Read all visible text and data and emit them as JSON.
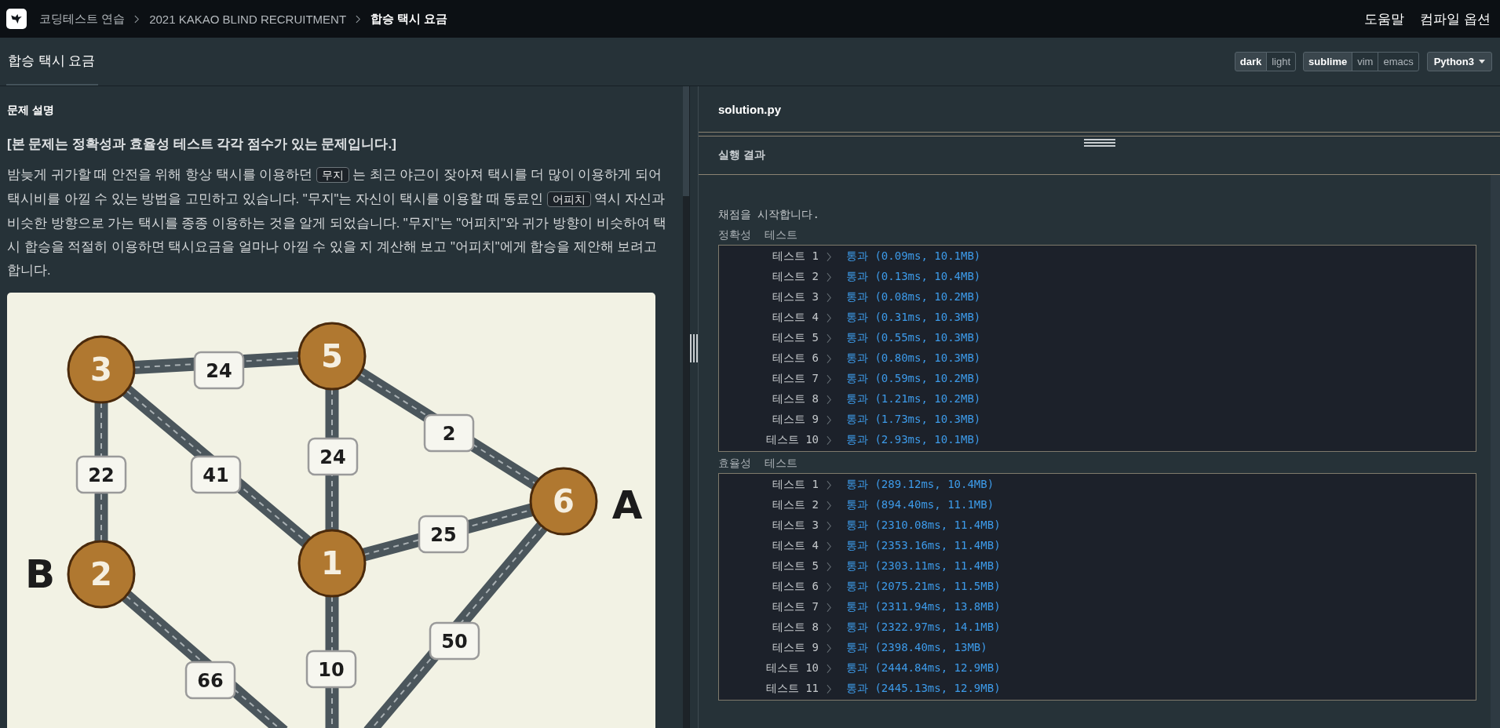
{
  "nav": {
    "breadcrumbs": [
      "코딩테스트 연습",
      "2021 KAKAO BLIND RECRUITMENT",
      "합승 택시 요금"
    ],
    "links": [
      "도움말",
      "컴파일 옵션"
    ]
  },
  "header": {
    "title": "합승 택시 요금",
    "themes": [
      {
        "label": "dark",
        "selected": true
      },
      {
        "label": "light",
        "selected": false
      }
    ],
    "keymaps": [
      {
        "label": "sublime",
        "selected": true
      },
      {
        "label": "vim",
        "selected": false
      },
      {
        "label": "emacs",
        "selected": false
      }
    ],
    "language": "Python3"
  },
  "problem": {
    "section": "문제 설명",
    "notice": "[본 문제는 정확성과 효율성 테스트 각각 점수가 있는 문제입니다.]",
    "paragraph": [
      {
        "kind": "text",
        "text": "밤늦게 귀가할 때 안전을 위해 항상 택시를 이용하던 "
      },
      {
        "kind": "code",
        "text": "무지"
      },
      {
        "kind": "text",
        "text": " 는 최근 야근이 잦아져 택시를 더 많이 이용하게 되어 택시비를 아낄 수 있는 방법을 고민하고 있습니다. \"무지\"는 자신이 택시를 이용할 때 동료인 "
      },
      {
        "kind": "code",
        "text": "어피치"
      },
      {
        "kind": "text",
        "text": " 역시 자신과 비슷한 방향으로 가는 택시를 종종 이용하는 것을 알게 되었습니다. \"무지\"는 \"어피치\"와 귀가 방향이 비슷하여 택시 합승을 적절히 이용하면 택시요금을 얼마나 아낄 수 있을 지 계산해 보고 \"어피치\"에게 합승을 제안해 보려고 합니다."
      }
    ],
    "diagram": {
      "nodes": [
        "3",
        "5",
        "2",
        "1",
        "6"
      ],
      "tags": [
        "A",
        "B"
      ],
      "weights": [
        "24",
        "22",
        "41",
        "24",
        "2",
        "25",
        "66",
        "10",
        "50"
      ]
    }
  },
  "editor": {
    "filename": "solution.py"
  },
  "results": {
    "title": "실행 결과",
    "start": "채점을 시작합니다.",
    "groups": [
      {
        "title": "정확성  테스트",
        "rows": [
          {
            "label": "테스트 1",
            "result": "통과 (0.09ms, 10.1MB)"
          },
          {
            "label": "테스트 2",
            "result": "통과 (0.13ms, 10.4MB)"
          },
          {
            "label": "테스트 3",
            "result": "통과 (0.08ms, 10.2MB)"
          },
          {
            "label": "테스트 4",
            "result": "통과 (0.31ms, 10.3MB)"
          },
          {
            "label": "테스트 5",
            "result": "통과 (0.55ms, 10.3MB)"
          },
          {
            "label": "테스트 6",
            "result": "통과 (0.80ms, 10.3MB)"
          },
          {
            "label": "테스트 7",
            "result": "통과 (0.59ms, 10.2MB)"
          },
          {
            "label": "테스트 8",
            "result": "통과 (1.21ms, 10.2MB)"
          },
          {
            "label": "테스트 9",
            "result": "통과 (1.73ms, 10.3MB)"
          },
          {
            "label": "테스트 10",
            "result": "통과 (2.93ms, 10.1MB)"
          }
        ]
      },
      {
        "title": "효율성  테스트",
        "rows": [
          {
            "label": "테스트 1",
            "result": "통과 (289.12ms, 10.4MB)"
          },
          {
            "label": "테스트 2",
            "result": "통과 (894.40ms, 11.1MB)"
          },
          {
            "label": "테스트 3",
            "result": "통과 (2310.08ms, 11.4MB)"
          },
          {
            "label": "테스트 4",
            "result": "통과 (2353.16ms, 11.4MB)"
          },
          {
            "label": "테스트 5",
            "result": "통과 (2303.11ms, 11.4MB)"
          },
          {
            "label": "테스트 6",
            "result": "통과 (2075.21ms, 11.5MB)"
          },
          {
            "label": "테스트 7",
            "result": "통과 (2311.94ms, 13.8MB)"
          },
          {
            "label": "테스트 8",
            "result": "통과 (2322.97ms, 14.1MB)"
          },
          {
            "label": "테스트 9",
            "result": "통과 (2398.40ms, 13MB)"
          },
          {
            "label": "테스트 10",
            "result": "통과 (2444.84ms, 12.9MB)"
          },
          {
            "label": "테스트 11",
            "result": "통과 (2445.13ms, 12.9MB)"
          }
        ]
      }
    ]
  }
}
